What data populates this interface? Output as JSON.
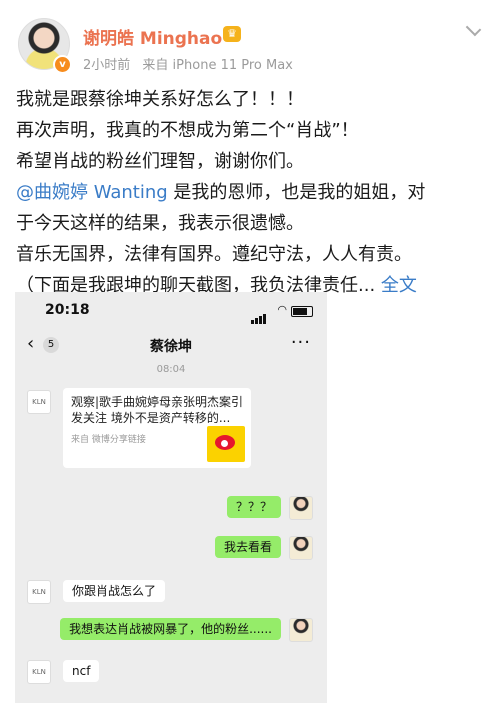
{
  "post": {
    "username": "谢明皓 Minghao",
    "verified_badge_icon": "v-badge-icon",
    "member_icon": "crown-icon",
    "time": "2小时前",
    "source": "来自 iPhone 11 Pro Max",
    "lines": [
      "我就是跟蔡徐坤关系好怎么了！！！",
      "再次声明，我真的不想成为第二个“肖战”！",
      "希望肖战的粉丝们理智，谢谢你们。"
    ],
    "mention": "@曲婉婷 Wanting",
    "mention_rest": " 是我的恩师，也是我的姐姐，对",
    "line5": "于今天这样的结果，我表示很遗憾。",
    "line6": "音乐无国界，法律有国界。遵纪守法，人人有责。",
    "line7": "（下面是我跟坤的聊天截图，我负法律责任...",
    "full_text_link": "全文"
  },
  "screenshot": {
    "time": "20:18",
    "back_count": "5",
    "chat_title": "蔡徐坤",
    "timestamp": "08:04",
    "contact_avatar_text": "KLN",
    "card_title": "观察|歌手曲婉婷母亲张明杰案引发关注 境外不是资产转移的...",
    "card_source": "来自  微博分享链接",
    "messages": [
      {
        "side": "right",
        "text": "？？？"
      },
      {
        "side": "right",
        "text": "我去看看"
      },
      {
        "side": "left",
        "text": "你跟肖战怎么了"
      },
      {
        "side": "right",
        "text": "我想表达肖战被网暴了，他的粉丝......"
      },
      {
        "side": "left",
        "text": "ncf"
      }
    ]
  },
  "colors": {
    "username": "#eb7350",
    "link": "#3a7cc7",
    "wechat_green": "#95ec69",
    "chat_bg": "#ededed"
  }
}
